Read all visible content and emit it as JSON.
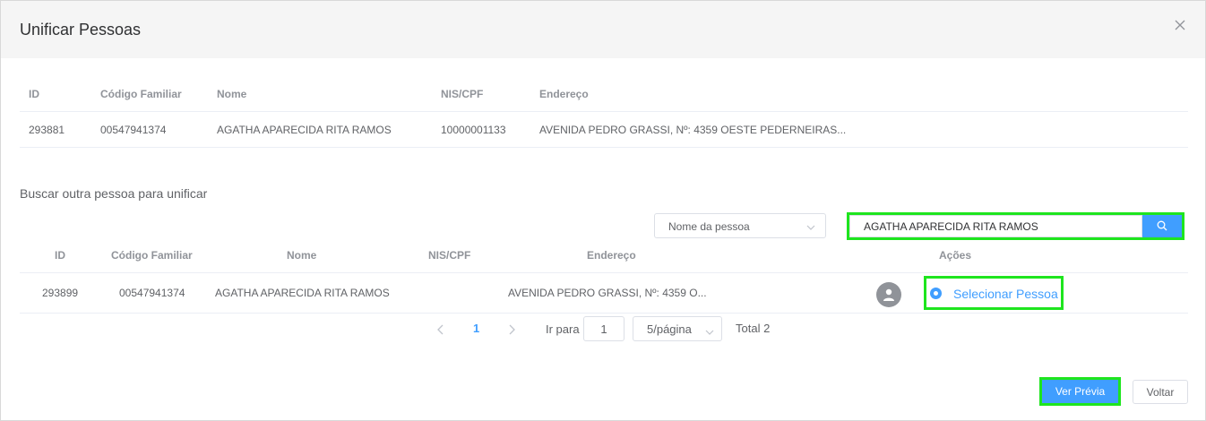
{
  "dialog": {
    "title": "Unificar Pessoas"
  },
  "person_table": {
    "columns": [
      "ID",
      "Código Familiar",
      "Nome",
      "NIS/CPF",
      "Endereço"
    ],
    "row": {
      "id": "293881",
      "codigo": "00547941374",
      "nome": "AGATHA APARECIDA RITA RAMOS",
      "nis": "10000001133",
      "endereco": "AVENIDA PEDRO GRASSI, Nº: 4359 OESTE PEDERNEIRAS..."
    }
  },
  "search": {
    "label": "Buscar outra pessoa para unificar",
    "filter_select": "Nome da pessoa",
    "query": "AGATHA APARECIDA RITA RAMOS"
  },
  "results_table": {
    "columns": [
      "ID",
      "Código Familiar",
      "Nome",
      "NIS/CPF",
      "Endereço",
      "Ações"
    ],
    "row": {
      "id": "293899",
      "codigo": "00547941374",
      "nome": "AGATHA APARECIDA RITA RAMOS",
      "nis": "",
      "endereco": "AVENIDA PEDRO GRASSI, Nº: 4359 O...",
      "action_label": "Selecionar Pessoa"
    }
  },
  "pagination": {
    "current_page": "1",
    "goto_label": "Ir para",
    "goto_value": "1",
    "page_size": "5/página",
    "total": "Total 2"
  },
  "footer": {
    "preview_label": "Ver Prévia",
    "back_label": "Voltar"
  },
  "colors": {
    "accent": "#409eff",
    "highlight": "#1ee51e",
    "avatar": "#909399"
  },
  "icons": [
    "close-icon",
    "chevron-down-icon",
    "search-icon",
    "user-icon",
    "chevron-left-icon",
    "chevron-right-icon"
  ]
}
